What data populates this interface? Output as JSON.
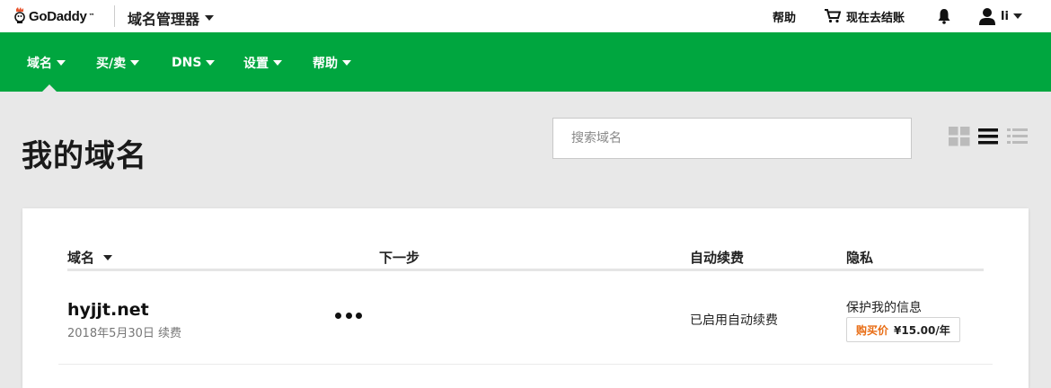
{
  "topbar": {
    "logo_text": "GoDaddy",
    "logo_tm": "™",
    "product_menu": "域名管理器",
    "help": "帮助",
    "cart": "现在去结账",
    "user": "li"
  },
  "nav": {
    "items": [
      {
        "label": "域名"
      },
      {
        "label": "买/卖"
      },
      {
        "label": "DNS"
      },
      {
        "label": "设置"
      },
      {
        "label": "帮助"
      }
    ]
  },
  "header": {
    "title": "我的域名",
    "search_placeholder": "搜索域名"
  },
  "table": {
    "columns": {
      "domain": "域名",
      "next_step": "下一步",
      "auto_renew": "自动续费",
      "privacy": "隐私"
    },
    "rows": [
      {
        "domain": "hyjjt.net",
        "meta": "2018年5月30日 续费",
        "auto_renew": "已启用自动续费",
        "privacy_label": "保护我的信息",
        "buy_label": "购买价",
        "buy_price": "¥15.00/年"
      }
    ]
  },
  "colors": {
    "brand_green": "#00a63f",
    "accent_orange": "#e86c13"
  }
}
